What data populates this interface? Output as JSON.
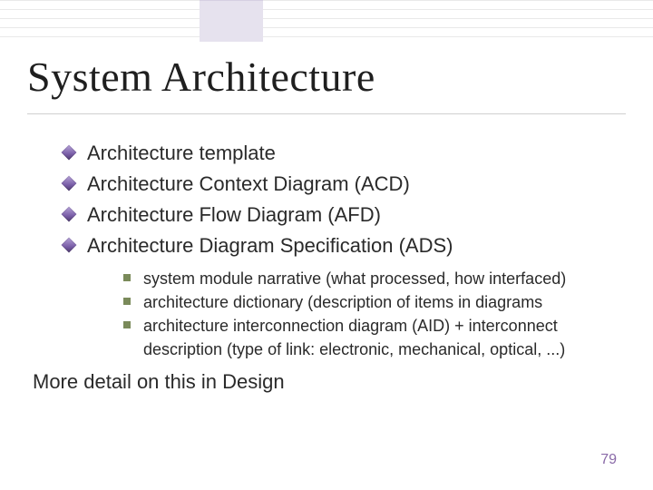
{
  "title": "System Architecture",
  "bullets": [
    "Architecture template",
    "Architecture Context Diagram (ACD)",
    "Architecture Flow Diagram (AFD)",
    "Architecture Diagram Specification (ADS)"
  ],
  "sub_bullets": [
    "system module narrative (what processed, how interfaced)",
    "architecture dictionary (description of items in diagrams",
    "architecture interconnection diagram (AID) + interconnect description (type of link: electronic, mechanical, optical, ...)"
  ],
  "footer": "More detail on this in Design",
  "page_number": "79",
  "colors": {
    "accent_diamond": "#7a5ea8",
    "accent_square": "#7a8a5a",
    "page_number": "#8a6aa8"
  }
}
